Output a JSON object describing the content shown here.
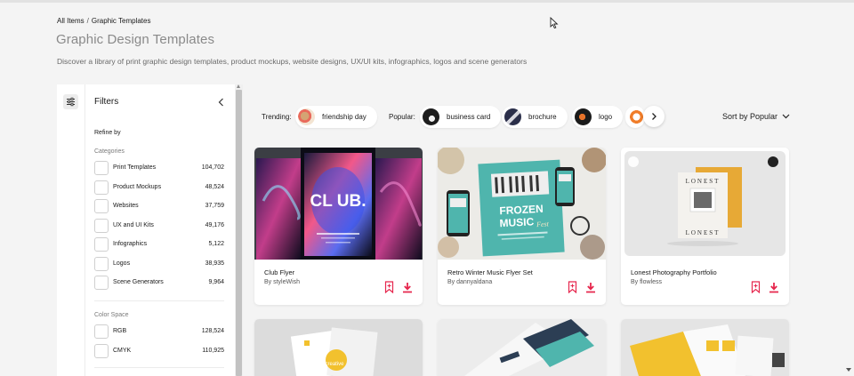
{
  "breadcrumb": {
    "root": "All Items",
    "separator": "/",
    "current": "Graphic Templates"
  },
  "header": {
    "title": "Graphic Design Templates",
    "subtitle": "Discover a library of print graphic design templates, product mockups, website designs, UX/UI kits, infographics, logos and scene generators"
  },
  "filters": {
    "title": "Filters",
    "refine_by": "Refine by",
    "categories_title": "Categories",
    "categories": [
      {
        "label": "Print Templates",
        "count": "104,702"
      },
      {
        "label": "Product Mockups",
        "count": "48,524"
      },
      {
        "label": "Websites",
        "count": "37,759"
      },
      {
        "label": "UX and UI Kits",
        "count": "49,176"
      },
      {
        "label": "Infographics",
        "count": "5,122"
      },
      {
        "label": "Logos",
        "count": "38,935"
      },
      {
        "label": "Scene Generators",
        "count": "9,964"
      }
    ],
    "color_space_title": "Color Space",
    "color_spaces": [
      {
        "label": "RGB",
        "count": "128,524"
      },
      {
        "label": "CMYK",
        "count": "110,925"
      }
    ]
  },
  "trending": {
    "label": "Trending:",
    "items": [
      {
        "label": "friendship day"
      }
    ],
    "popular_label": "Popular:",
    "popular": [
      {
        "label": "business card"
      },
      {
        "label": "brochure"
      },
      {
        "label": "logo"
      }
    ]
  },
  "sort": {
    "label": "Sort by Popular"
  },
  "items": [
    {
      "title": "Club Flyer",
      "author": "By styleWish"
    },
    {
      "title": "Retro Winter Music Flyer Set",
      "author": "By dannyaldana"
    },
    {
      "title": "Lonest Photography Portfolio",
      "author": "By flowless"
    }
  ],
  "thumb_text": {
    "club": "CL UB.",
    "frozen_line1": "FROZEN",
    "frozen_line2": "MUSIC",
    "frozen_script": "Fest",
    "lonest": "LONEST",
    "creative": "creative"
  },
  "colors": {
    "accent": "#e6264d",
    "background": "#f4f4f4",
    "teal": "#4fb5ad",
    "yellow": "#f2c12e"
  },
  "icons": {
    "filter_toggle": "sliders-icon",
    "collapse": "chevron-left-icon",
    "next": "chevron-right-icon",
    "sort": "chevron-down-icon",
    "bookmark": "bookmark-icon",
    "download": "download-icon"
  }
}
